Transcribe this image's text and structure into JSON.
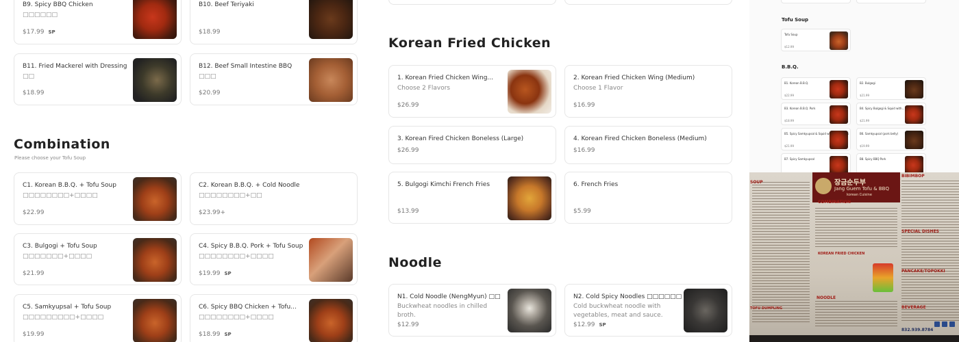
{
  "left_column": {
    "items": [
      {
        "name": "B9. Spicy BBQ Chicken",
        "sub": "□□□□□□",
        "price": "$17.99",
        "sp": "SP"
      },
      {
        "name": "B10. Beef Teriyaki",
        "sub": "",
        "price": "$18.99",
        "sp": ""
      },
      {
        "name": "B11. Fried Mackerel with Dressing",
        "sub": "□□",
        "price": "$18.99",
        "sp": ""
      },
      {
        "name": "B12. Beef Small Intestine BBQ",
        "sub": "□□□",
        "price": "$20.99",
        "sp": ""
      }
    ],
    "combination": {
      "title": "Combination",
      "note": "Please choose your Tofu Soup",
      "items": [
        {
          "name": "C1. Korean B.B.Q. + Tofu Soup",
          "sub": "□□□□□□□□+□□□□",
          "price": "$22.99",
          "sp": ""
        },
        {
          "name": "C2. Korean B.B.Q. + Cold Noodle",
          "sub": "□□□□□□□□+□□",
          "price": "$23.99+",
          "sp": ""
        },
        {
          "name": "C3. Bulgogi + Tofu Soup",
          "sub": "□□□□□□□+□□□□",
          "price": "$21.99",
          "sp": ""
        },
        {
          "name": "C4. Spicy B.B.Q. Pork + Tofu Soup",
          "sub": "□□□□□□□□+□□□□",
          "price": "$19.99",
          "sp": "SP"
        },
        {
          "name": "C5. Samkyupsal + Tofu Soup",
          "sub": "□□□□□□□□□+□□□□",
          "price": "$19.99",
          "sp": ""
        },
        {
          "name": "C6. Spicy BBQ Chicken + Tofu...",
          "sub": "□□□□□□□□+□□□□",
          "price": "$18.99",
          "sp": "SP"
        }
      ]
    }
  },
  "middle_column": {
    "fried_chicken": {
      "title": "Korean Fried Chicken",
      "items": [
        {
          "name": "1. Korean Fried Chicken Wing...",
          "sub": "Choose 2 Flavors",
          "price": "$26.99",
          "sp": ""
        },
        {
          "name": "2. Korean Fried Chicken Wing (Medium)",
          "sub": "Choose 1 Flavor",
          "price": "$16.99",
          "sp": ""
        },
        {
          "name": "3. Korean Fired Chicken Boneless (Large)",
          "sub": "",
          "price": "$26.99",
          "sp": ""
        },
        {
          "name": "4. Korean Fired Chicken Boneless (Medium)",
          "sub": "",
          "price": "$16.99",
          "sp": ""
        },
        {
          "name": "5. Bulgogi Kimchi French Fries",
          "sub": "",
          "price": "$13.99",
          "sp": ""
        },
        {
          "name": "6. French Fries",
          "sub": "",
          "price": "$5.99",
          "sp": ""
        }
      ]
    },
    "noodle": {
      "title": "Noodle",
      "items": [
        {
          "name": "N1. Cold Noodle (NengMyun) □□",
          "sub": "Buckwheat noodles in chilled broth.",
          "price": "$12.99",
          "sp": ""
        },
        {
          "name": "N2. Cold Spicy Noodles □□□□□□",
          "sub": "Cold buckwheat noodle with vegetables, meat and sauce.",
          "price": "$12.99",
          "sp": "SP"
        }
      ]
    }
  },
  "right_panel": {
    "tofu_title": "Tofu Soup",
    "tofu_item": {
      "name": "Tofu Soup",
      "price": "$12.99"
    },
    "bbq_title": "B.B.Q.",
    "bbq_items": [
      {
        "name": "B1. Korean B.B.Q.",
        "price": "$22.99"
      },
      {
        "name": "B2. Bulgogi",
        "price": "$21.99"
      },
      {
        "name": "B3. Korean B.B.Q. Pork",
        "price": "$18.99"
      },
      {
        "name": "B4. Spicy Bulgogi & Squid with...",
        "price": "$21.99"
      },
      {
        "name": "B5. Spicy Samkyupsal & Squid with Vegetables",
        "price": "$21.99"
      },
      {
        "name": "B6. Samkyupsal (pork belly)",
        "price": "$19.99"
      },
      {
        "name": "B7. Spicy Samkyupsal",
        "price": ""
      },
      {
        "name": "B8. Spicy BBQ Pork",
        "price": ""
      }
    ],
    "menu_photo": {
      "korean_title": "장금순두부",
      "english_title": "Jang Guem Tofu & BBQ",
      "subtitle": "korean Cuisine",
      "sections": [
        "SOUP",
        "COMBINATION",
        "KOREAN FRIED CHICKEN",
        "NOODLE",
        "TOFU DUMPLING",
        "BIBIMBOP",
        "SPECIAL DISHES",
        "PANCAKE/TOPOKKI",
        "BEVERAGE"
      ],
      "phone": "832.939.8784"
    }
  }
}
